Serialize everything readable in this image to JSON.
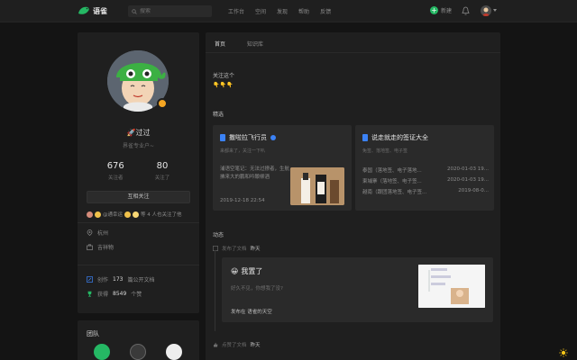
{
  "app": {
    "name": "语雀"
  },
  "search": {
    "placeholder": "搜索"
  },
  "nav": [
    "工作台",
    "空间",
    "发现",
    "帮助",
    "反馈"
  ],
  "header": {
    "new_label": "新建"
  },
  "profile": {
    "name": "过过",
    "desc": "界雀专业户~",
    "following": {
      "value": "676",
      "label": "关注者"
    },
    "followers": {
      "value": "80",
      "label": "关注了"
    },
    "follow_btn": "互相关注",
    "mutual_text": "等 4 人也关注了他",
    "mutual_name": "@通幸运",
    "location": "杭州",
    "job": "吉祥物",
    "docs_prefix": "创作",
    "docs_count": "173",
    "docs_suffix": "篇公开文档",
    "likes_prefix": "获得",
    "likes_count": "8549",
    "likes_suffix": "个赞"
  },
  "team": {
    "title": "团队"
  },
  "tabs": [
    "首页",
    "知识库"
  ],
  "bio": {
    "line1": "关注这个",
    "line2": "👇👇👇"
  },
  "featured": {
    "title": "精选",
    "card1": {
      "name": "撒啦拉飞行员",
      "sub": "来都来了，关注一下叭",
      "body": "浦语空笔记：无法过撩者，生航拂来大的鹏和吟酿柳酒",
      "date": "2019-12-18 22:54"
    },
    "card2": {
      "name": "说走就走的签证大全",
      "sub": "免签、落地签、电子签",
      "items": [
        {
          "t": "泰国（落地签、电子落地...",
          "d": "2020-01-03 19..."
        },
        {
          "t": "柬埔寨（落地签、电子签...",
          "d": "2020-01-03 19..."
        },
        {
          "t": "越南（跟团落地签、电子签...",
          "d": "2019-08-0..."
        }
      ]
    }
  },
  "activity": {
    "title": "动态",
    "item1": {
      "action": "发布了文档",
      "time": "昨天"
    },
    "doc": {
      "emoji": "😀",
      "title": "我置了",
      "sub": "好久不见，你想我了没?",
      "foot_prefix": "发布在",
      "foot_space": "语雀的天空"
    },
    "item2": {
      "action": "点赞了文档",
      "time": "昨天"
    }
  }
}
